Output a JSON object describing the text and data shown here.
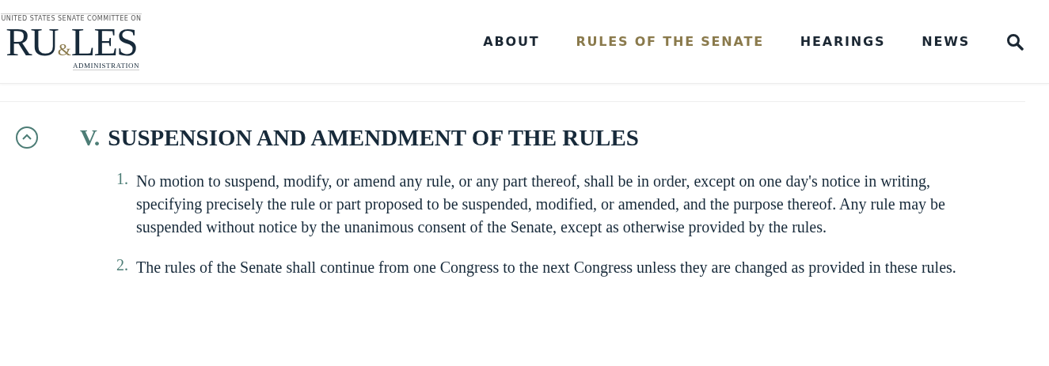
{
  "logo": {
    "top_line": "UNITED STATES SENATE COMMITTEE ON",
    "word_left": "RU",
    "ampersand": "&",
    "word_right": "LES",
    "bottom_line": "ADMINISTRATION"
  },
  "nav": [
    {
      "label": "ABOUT",
      "selected": false
    },
    {
      "label": "RULES OF THE SENATE",
      "selected": true
    },
    {
      "label": "HEARINGS",
      "selected": false
    },
    {
      "label": "NEWS",
      "selected": false
    }
  ],
  "section": {
    "expanded": true,
    "number": "V.",
    "title": "SUSPENSION AND AMENDMENT OF THE RULES",
    "items": [
      {
        "number": "1.",
        "text": "No motion to suspend, modify, or amend any rule, or any part thereof, shall be in order, except on one day's notice in writing, specifying precisely the rule or part proposed to be suspended, modified, or amended, and the purpose thereof. Any rule may be suspended without notice by the unanimous consent of the Senate, except as otherwise provided by the rules."
      },
      {
        "number": "2.",
        "text": "The rules of the Senate shall continue from one Congress to the next Congress unless they are changed as provided in these rules."
      }
    ]
  }
}
